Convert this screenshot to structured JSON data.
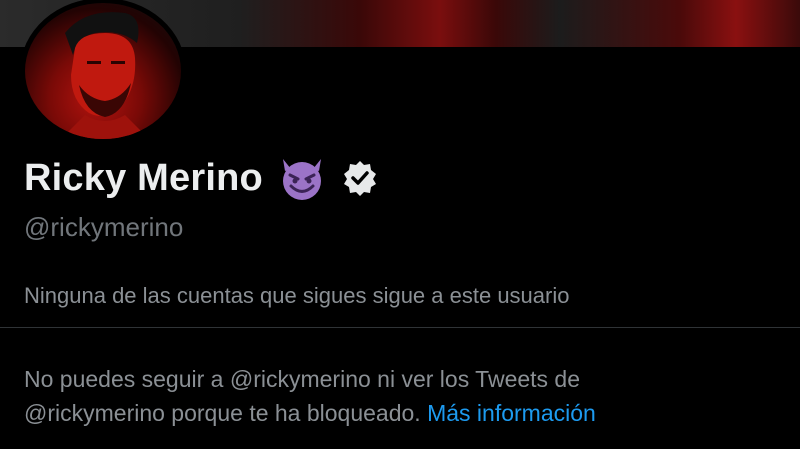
{
  "profile": {
    "display_name": "Ricky Merino",
    "handle": "@rickymerino",
    "name_emoji": "smiling-face-with-horns-icon",
    "verified": true
  },
  "followers_note": "Ninguna de las cuentas que sigues sigue a este usuario",
  "blocked_notice": {
    "line1": "No puedes seguir a @rickymerino ni ver los Tweets de",
    "line2_prefix": "@rickymerino porque te ha bloqueado. ",
    "link_label": "Más información"
  },
  "colors": {
    "background": "#000000",
    "primary_text": "#e7e9ea",
    "secondary_text": "#71767b",
    "link": "#1d9bf0",
    "emoji": "#9b73c7"
  }
}
